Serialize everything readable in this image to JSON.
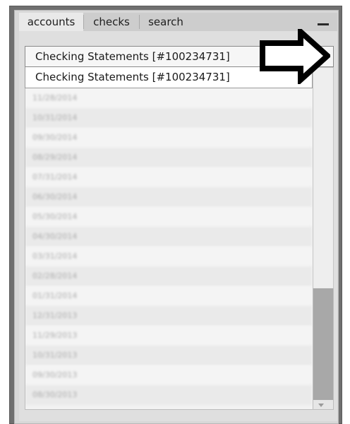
{
  "tabs": [
    {
      "label": "accounts",
      "active": true
    },
    {
      "label": "checks",
      "active": false
    },
    {
      "label": "search",
      "active": false
    }
  ],
  "minimize_icon": "minimize-icon",
  "account_select": {
    "selected_value": "Checking Statements [#100234731]",
    "options": [
      "Checking Statements [#100234731]"
    ]
  },
  "statements": [
    "11/28/2014",
    "10/31/2014",
    "09/30/2014",
    "08/29/2014",
    "07/31/2014",
    "06/30/2014",
    "05/30/2014",
    "04/30/2014",
    "03/31/2014",
    "02/28/2014",
    "01/31/2014",
    "12/31/2013",
    "11/29/2013",
    "10/31/2013",
    "09/30/2013",
    "08/30/2013"
  ],
  "annotation_icon": "right-arrow-icon",
  "colors": {
    "frame": "#6f6f6f",
    "panel": "#d8d8d8",
    "active_tab": "#e9e9e9",
    "scroll_thumb": "#a8a8a8"
  }
}
